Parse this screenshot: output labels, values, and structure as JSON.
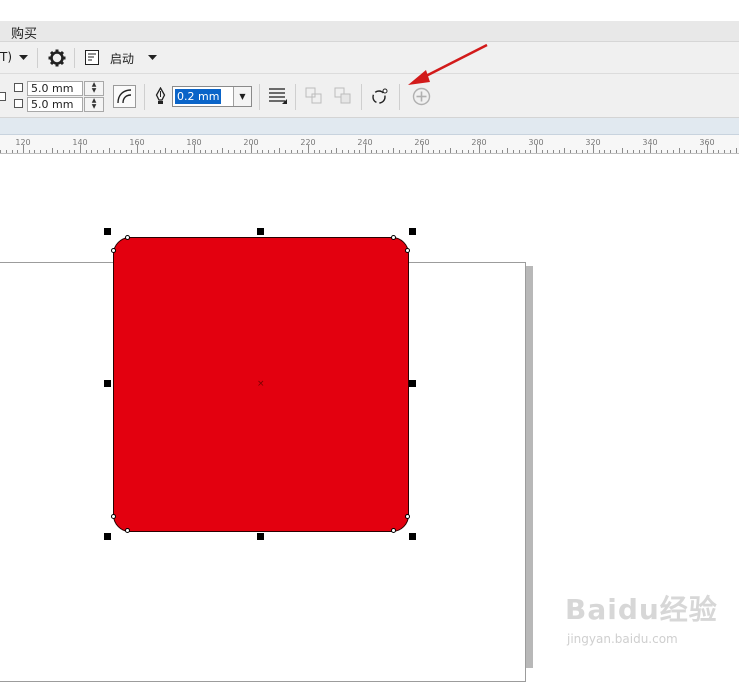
{
  "menubar": {
    "buy_label": "购买"
  },
  "toolbar1": {
    "partial_label": "T)",
    "launch_label": "启动"
  },
  "toolbar2": {
    "corner_top": "5.0 mm",
    "corner_bottom": "5.0 mm",
    "outline_width": "0.2 mm"
  },
  "ruler": {
    "ticks": [
      "120",
      "140",
      "160",
      "180",
      "200",
      "220",
      "240",
      "260",
      "280",
      "300",
      "320",
      "340",
      "360"
    ]
  },
  "watermark": {
    "brand": "Baidu经验",
    "site": "jingyan.baidu.com"
  },
  "colors": {
    "shape_fill": "#e3000f",
    "selection_highlight": "#0a64c8",
    "annotation_arrow": "#d21a1a"
  },
  "icons": [
    "dropdown-arrow-icon",
    "gear-icon",
    "launch-icon",
    "corner-check-icon",
    "corner-style-icon",
    "pen-icon",
    "text-wrap-icon",
    "ungroup-icon",
    "combine-icon",
    "convert-to-curves-icon",
    "add-icon"
  ]
}
